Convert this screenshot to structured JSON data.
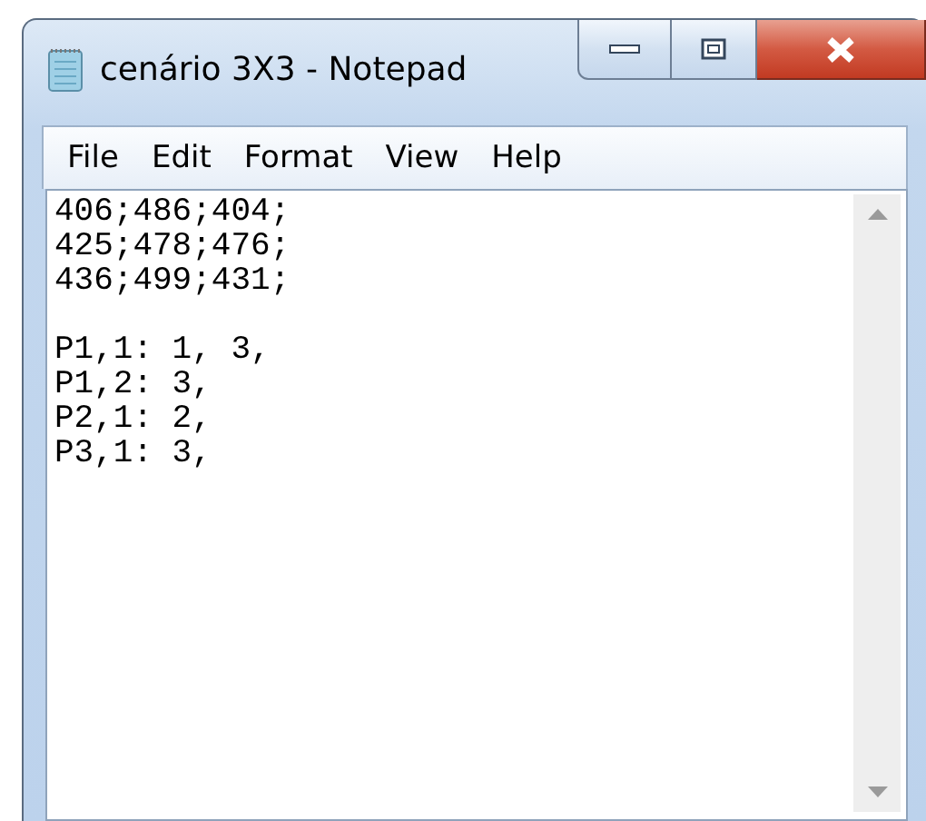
{
  "window": {
    "title": "cenário 3X3 - Notepad"
  },
  "menu": [
    "File",
    "Edit",
    "Format",
    "View",
    "Help"
  ],
  "editor": {
    "paragraphs": [
      [
        "406;486;404;",
        "425;478;476;",
        "436;499;431;"
      ],
      [
        "P1,1: 1, 3,",
        "P1,2: 3,",
        "P2,1: 2,",
        "P3,1: 3,"
      ]
    ]
  }
}
